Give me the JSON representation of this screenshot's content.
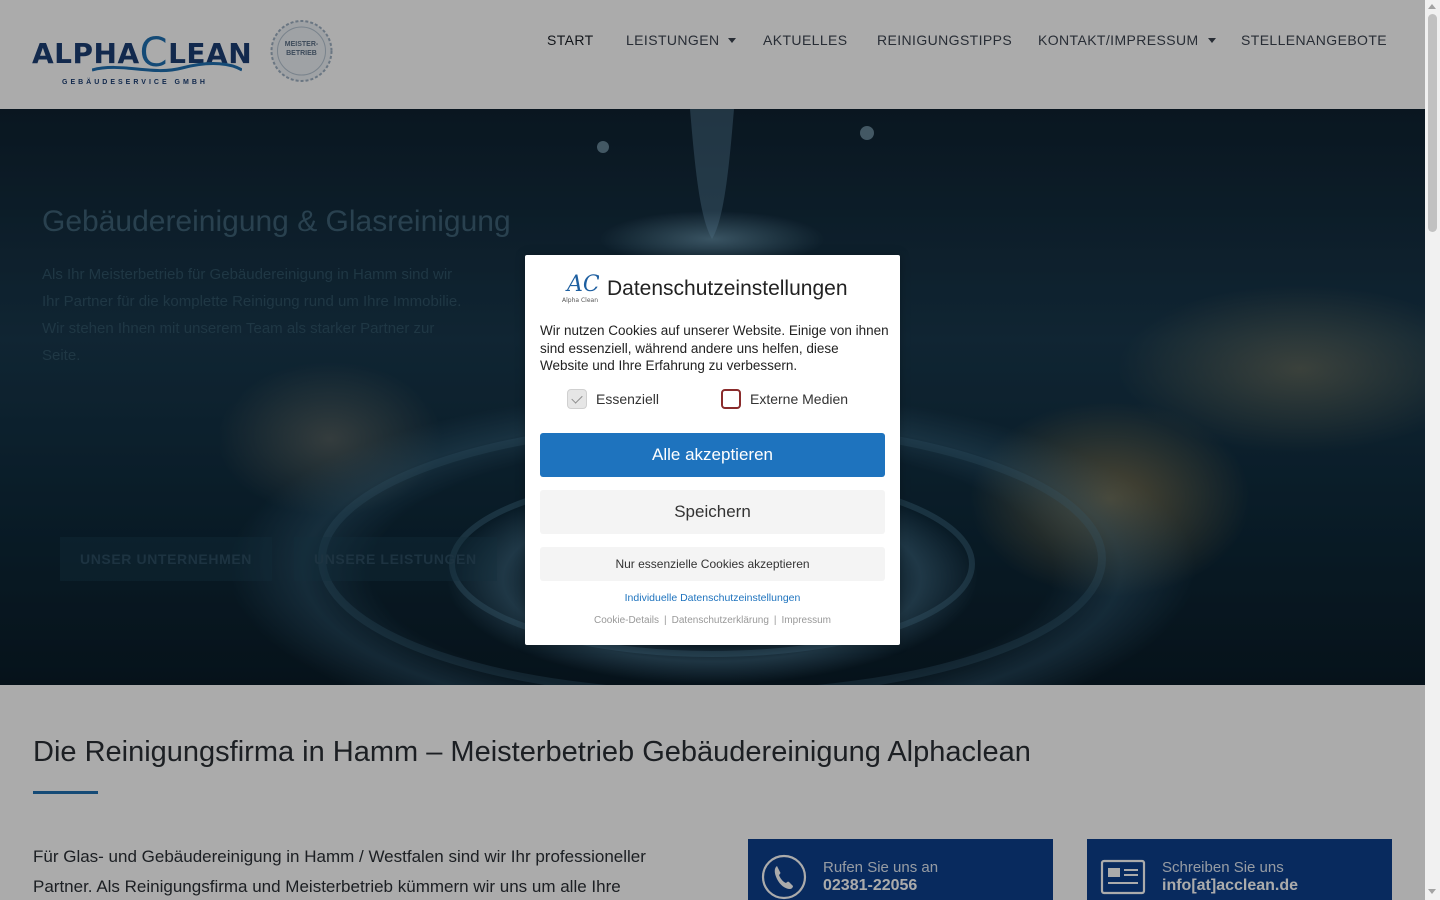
{
  "header": {
    "logo_text_a": "ALPHA",
    "logo_text_c": "C",
    "logo_text_b": "LEAN",
    "logo_sub": "GEBÄUDESERVICE GMBH",
    "seal_line1": "MEISTER-",
    "seal_line2": "BETRIEB",
    "nav": [
      {
        "label": "START",
        "has_dropdown": false,
        "active": true
      },
      {
        "label": "LEISTUNGEN",
        "has_dropdown": true,
        "active": false
      },
      {
        "label": "AKTUELLES",
        "has_dropdown": false,
        "active": false
      },
      {
        "label": "REINIGUNGSTIPPS",
        "has_dropdown": false,
        "active": false
      },
      {
        "label": "KONTAKT/IMPRESSUM",
        "has_dropdown": true,
        "active": false
      },
      {
        "label": "STELLENANGEBOTE",
        "has_dropdown": false,
        "active": false
      }
    ]
  },
  "hero": {
    "title": "Gebäudereinigung & Glasreinigung",
    "text": "Als Ihr Meisterbetrieb für Gebäudereinigung in Hamm sind wir Ihr Partner für die komplette Reinigung rund um Ihre Immobilie. Wir stehen Ihnen mit unserem Team als starker Partner zur Seite.",
    "btn1": "UNSER UNTERNEHMEN",
    "btn2": "UNSERE LEISTUNGEN"
  },
  "main": {
    "title": "Die Reinigungsfirma in Hamm – Meisterbetrieb Gebäudereinigung Alphaclean",
    "text": "Für Glas- und Gebäudereinigung in Hamm / Westfalen sind wir Ihr professioneller Partner. Als Reinigungsfirma und Meisterbetrieb kümmern wir uns um alle Ihre",
    "contact_phone_label": "Rufen Sie uns an",
    "contact_phone_value": "02381-22056",
    "contact_mail_label": "Schreiben Sie uns",
    "contact_mail_value": "info[at]acclean.de"
  },
  "modal": {
    "logo_text": "AC",
    "logo_sub": "Alpha Clean",
    "title": "Datenschutzeinstellungen",
    "description": "Wir nutzen Cookies auf unserer Website. Einige von ihnen sind essenziell, während andere uns helfen, diese Website und Ihre Erfahrung zu verbessern.",
    "checkboxes": [
      {
        "label": "Essenziell",
        "checked": true,
        "disabled": true
      },
      {
        "label": "Externe Medien",
        "checked": false,
        "disabled": false
      }
    ],
    "accept_all": "Alle akzeptieren",
    "save": "Speichern",
    "essential_only": "Nur essenzielle Cookies akzeptieren",
    "individual": "Individuelle Datenschutzeinstellungen",
    "footer_links": [
      "Cookie-Details",
      "Datenschutzerklärung",
      "Impressum"
    ]
  },
  "colors": {
    "accent": "#1e73be",
    "brand_dark": "#1c3e73",
    "contact_bg": "#0d3f8c",
    "checkbox_border": "#8a2b2b"
  },
  "icons": {
    "phone": "phone-icon",
    "mail": "contact-card-icon",
    "caret": "caret-down-icon"
  }
}
